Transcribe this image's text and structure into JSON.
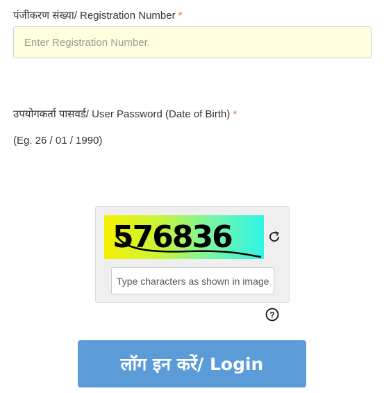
{
  "registration": {
    "label": "पंजीकरण संख्या/ Registration Number",
    "required_mark": "*",
    "placeholder": "Enter Registration Number.",
    "value": ""
  },
  "password": {
    "label": "उपयोगकर्ता पासवर्ड/ User Password (Date of Birth)",
    "required_mark": "*",
    "hint": "(Eg. 26 / 01 / 1990)"
  },
  "captcha": {
    "image_text": "576836",
    "refresh_icon": "refresh-icon",
    "input_placeholder": "Type characters as shown in image",
    "input_value": ""
  },
  "help": {
    "icon": "question-circle-icon"
  },
  "login": {
    "label": "लॉग इन करें/ Login"
  },
  "colors": {
    "required": "#e67e22",
    "input_bg": "#ffffe0",
    "button_bg": "#5a9bd8",
    "captcha_gradient_start": "#f5f000",
    "captcha_gradient_end": "#2ef5e6"
  }
}
